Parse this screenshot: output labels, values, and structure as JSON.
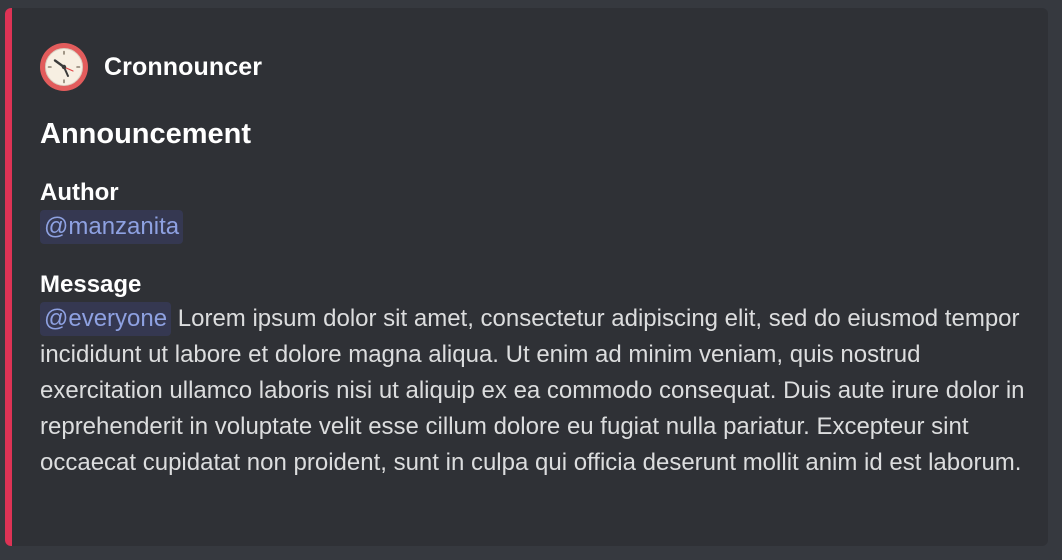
{
  "embed": {
    "accent_color": "#dd3355",
    "author": {
      "name": "Cronnouncer",
      "icon": "clock-icon"
    },
    "title": "Announcement",
    "fields": [
      {
        "name": "Author",
        "value": "@manzanita"
      },
      {
        "name": "Message",
        "mention": "@everyone",
        "value": "Lorem ipsum dolor sit amet, consectetur adipiscing elit, sed do eiusmod tempor incididunt ut labore et dolore magna aliqua. Ut enim ad minim veniam, quis nostrud exercitation ullamco laboris nisi ut aliquip ex ea commodo consequat. Duis aute irure dolor in reprehenderit in voluptate velit esse cillum dolore eu fugiat nulla pariatur. Excepteur sint occaecat cupidatat non proident, sunt in culpa qui officia deserunt mollit anim id est laborum."
      }
    ]
  },
  "colors": {
    "background": "#36393f",
    "embed_background": "#2f3136",
    "mention_text": "#8ea1e1"
  }
}
